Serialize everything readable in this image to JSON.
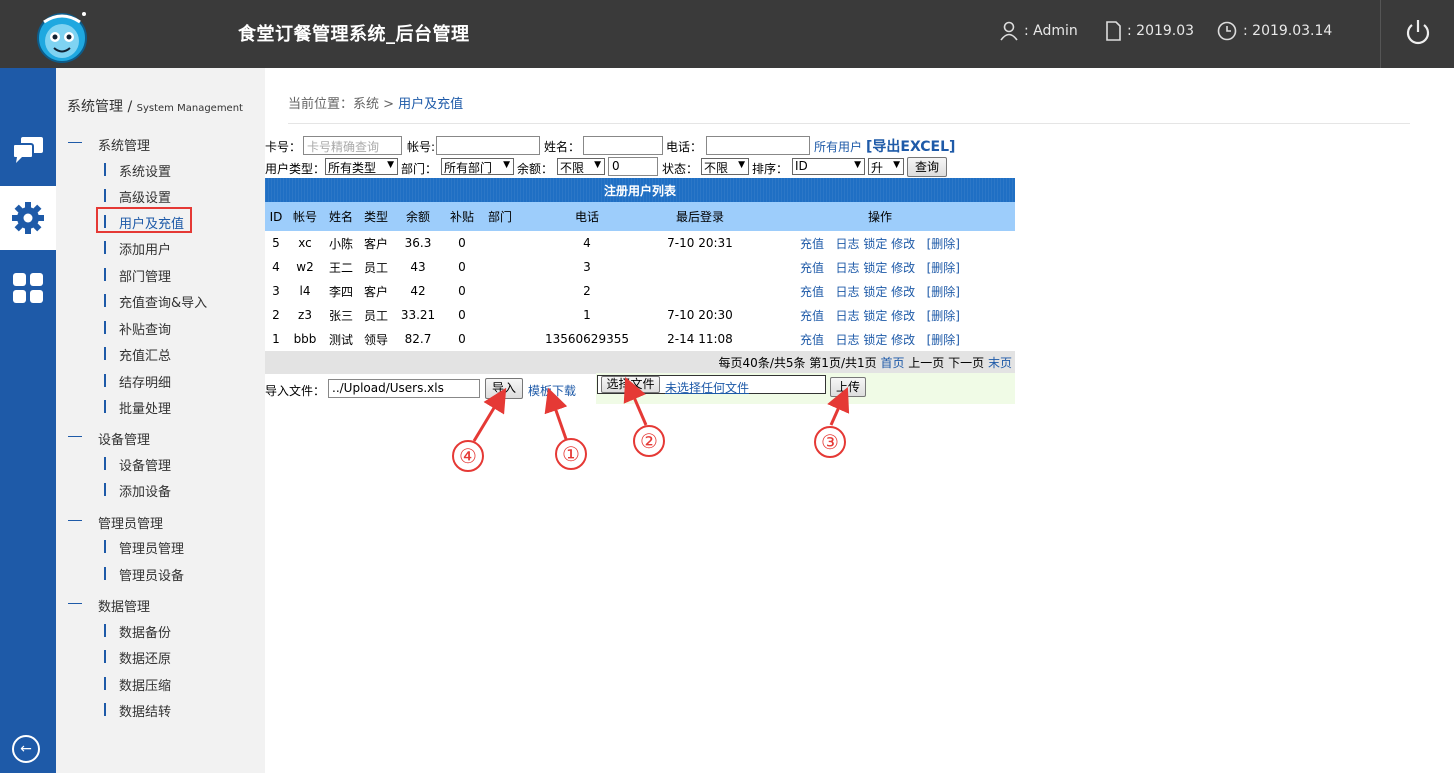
{
  "header": {
    "title": "食堂订餐管理系统_后台管理",
    "user": ": Admin",
    "version": ": 2019.03",
    "date": ": 2019.03.14"
  },
  "sidebar": {
    "title": "系统管理",
    "title_en": "System Management",
    "groups": [
      {
        "label": "系统管理",
        "items": [
          "系统设置",
          "高级设置",
          "用户及充值",
          "添加用户",
          "部门管理",
          "充值查询&导入",
          "补贴查询",
          "充值汇总",
          "结存明细",
          "批量处理"
        ]
      },
      {
        "label": "设备管理",
        "items": [
          "设备管理",
          "添加设备"
        ]
      },
      {
        "label": "管理员管理",
        "items": [
          "管理员管理",
          "管理员设备"
        ]
      },
      {
        "label": "数据管理",
        "items": [
          "数据备份",
          "数据还原",
          "数据压缩",
          "数据结转"
        ]
      }
    ],
    "active_item": "用户及充值"
  },
  "breadcrumb": {
    "prefix": "当前位置：系统 > ",
    "current": "用户及充值"
  },
  "filters": {
    "card_label": "卡号：",
    "card_placeholder": "卡号精确查询",
    "account_label": "帐号:",
    "name_label": "姓名：",
    "phone_label": "电话：",
    "all_users": "所有用户",
    "export": "[导出EXCEL]",
    "usertype_label": "用户类型：",
    "usertype_value": "所有类型",
    "dept_label": "部门：",
    "dept_value": "所有部门",
    "balance_label": "余额：",
    "balance_op": "不限",
    "balance_value": "0",
    "status_label": "状态：",
    "status_value": "不限",
    "sort_label": "排序：",
    "sort_value": "ID",
    "order_value": "升",
    "query_button": "查询"
  },
  "table": {
    "caption": "注册用户列表",
    "columns": [
      "ID",
      "帐号",
      "姓名",
      "类型",
      "余额",
      "补贴",
      "部门",
      "电话",
      "最后登录",
      "操作"
    ],
    "rows": [
      [
        "5",
        "xc",
        "小陈",
        "客户",
        "36.3",
        "0",
        "",
        "4",
        "7-10 20:31"
      ],
      [
        "4",
        "w2",
        "王二",
        "员工",
        "43",
        "0",
        "",
        "3",
        ""
      ],
      [
        "3",
        "l4",
        "李四",
        "客户",
        "42",
        "0",
        "",
        "2",
        ""
      ],
      [
        "2",
        "z3",
        "张三",
        "员工",
        "33.21",
        "0",
        "",
        "1",
        "7-10 20:30"
      ],
      [
        "1",
        "bbb",
        "测试",
        "领导",
        "82.7",
        "0",
        "",
        "13560629355",
        "2-14 11:08"
      ]
    ],
    "actions": {
      "recharge": "充值",
      "log": "日志",
      "lock": "锁定",
      "edit": "修改",
      "delete": "[删除]"
    },
    "pager": {
      "summary": "每页40条/共5条 第1页/共1页",
      "first": "首页",
      "prev": "上一页",
      "next": "下一页",
      "last": "末页"
    }
  },
  "import": {
    "label": "导入文件：",
    "path": "../Upload/Users.xls",
    "import_button": "导入",
    "template_link": "模板下载",
    "choose_button": "选择文件",
    "no_file": "未选择任何文件",
    "upload_button": "上传"
  },
  "annotations": [
    "④",
    "①",
    "②",
    "③"
  ],
  "colors": {
    "topbar": "#3a3a3a",
    "rail": "#1e5aa8",
    "accent": "#1e5aa8",
    "table_caption": "#1f6fc4",
    "table_header": "#9dcdfb",
    "annotation": "#e53935"
  }
}
